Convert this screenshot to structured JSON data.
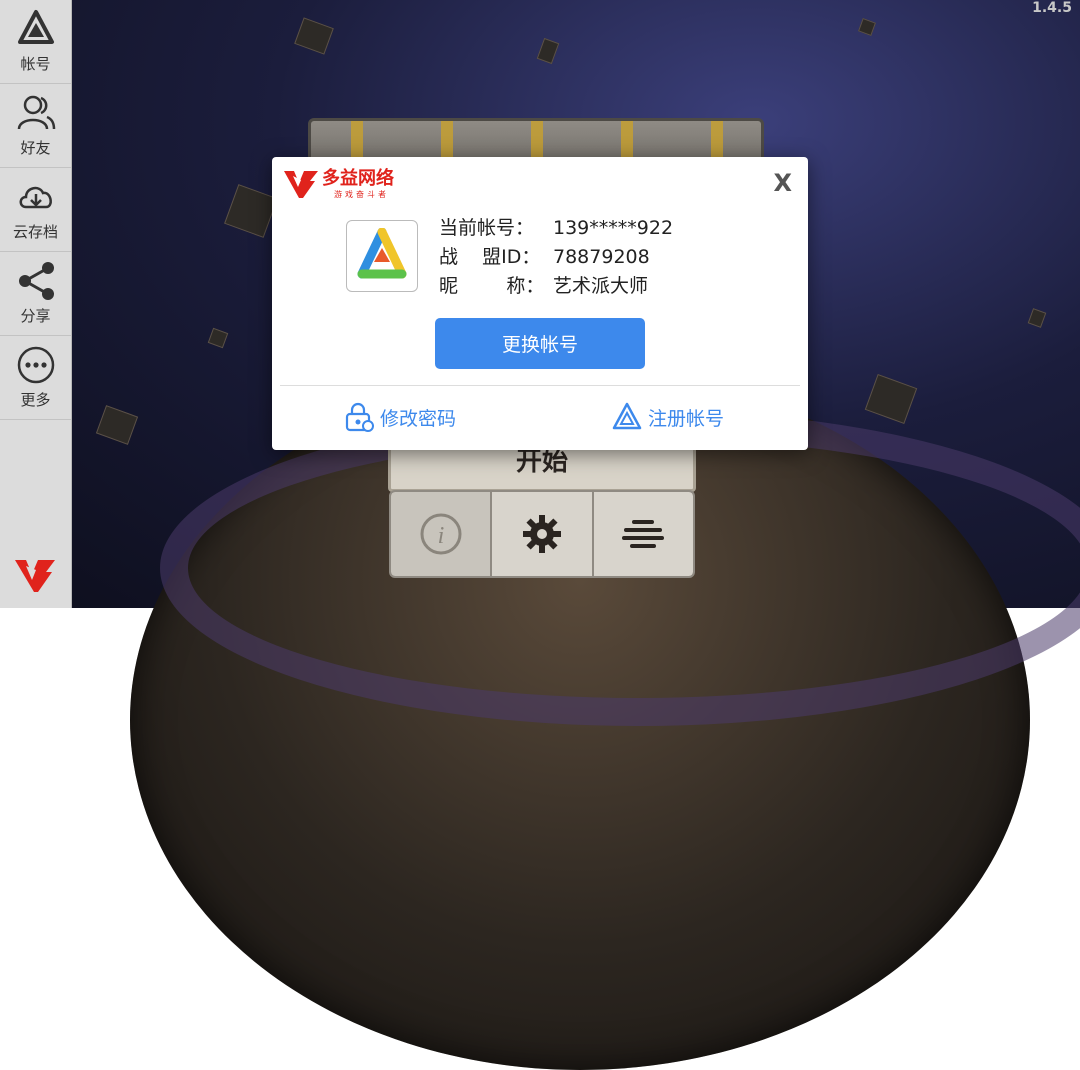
{
  "version": "1.4.5",
  "sidebar": {
    "items": [
      {
        "label": "帐号",
        "icon": "account-icon"
      },
      {
        "label": "好友",
        "icon": "friends-icon"
      },
      {
        "label": "云存档",
        "icon": "cloud-save-icon"
      },
      {
        "label": "分享",
        "icon": "share-icon"
      },
      {
        "label": "更多",
        "icon": "more-icon"
      }
    ]
  },
  "game": {
    "start_label": "开始"
  },
  "modal": {
    "brand_name": "多益网络",
    "brand_tagline": "游戏奋斗者",
    "close_label": "X",
    "current_account_label": "当前帐号：",
    "current_account_value": "139*****922",
    "alliance_id_label": "战    盟ID：",
    "alliance_id_value": "78879208",
    "nickname_label": "昵        称：",
    "nickname_value": "艺术派大师",
    "switch_account_label": "更换帐号",
    "change_password_label": "修改密码",
    "register_label": "注册帐号"
  },
  "colors": {
    "brand_red": "#e0231c",
    "accent_blue": "#3d89ec"
  }
}
